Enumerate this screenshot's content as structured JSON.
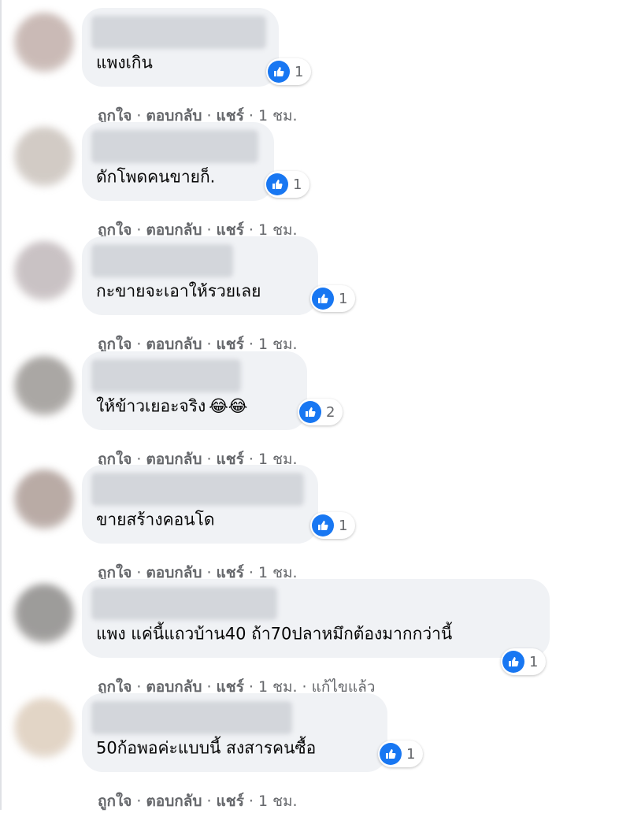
{
  "actions": {
    "like": "ถูกใจ",
    "reply": "ตอบกลับ",
    "share": "แชร์",
    "separator": "·"
  },
  "comments": [
    {
      "text": "แพงเกิน",
      "emoji": "",
      "reactions": "1",
      "time": "1 ชม.",
      "edited": "",
      "avatar_color": "#b9a49e"
    },
    {
      "text": "ดักโพดคนขายก็.",
      "emoji": "",
      "reactions": "1",
      "time": "1 ชม.",
      "edited": "",
      "avatar_color": "#c3bab2"
    },
    {
      "text": "กะขายจะเอาให้รวยเลย",
      "emoji": "",
      "reactions": "1",
      "time": "1 ชม.",
      "edited": "",
      "avatar_color": "#b8aeb1"
    },
    {
      "text": "ให้ข้าวเยอะจริง",
      "emoji": "😂😂",
      "reactions": "2",
      "time": "1 ชม.",
      "edited": "",
      "avatar_color": "#8e8a86"
    },
    {
      "text": "ขายสร้างคอนโด",
      "emoji": "",
      "reactions": "1",
      "time": "1 ชม.",
      "edited": "",
      "avatar_color": "#a28f88"
    },
    {
      "text": "แพง แค่นี้แถวบ้าน40 ถ้า70ปลาหมึกต้องมากกว่านี้",
      "emoji": "",
      "reactions": "1",
      "time": "1 ชม.",
      "edited": "แก้ไขแล้ว",
      "avatar_color": "#7d7b79"
    },
    {
      "text": "50ก้อพอค่ะแบบนี้ สงสารคนซื้อ",
      "emoji": "",
      "reactions": "1",
      "time": "1 ชม.",
      "edited": "",
      "avatar_color": "#d9c7b3"
    }
  ]
}
